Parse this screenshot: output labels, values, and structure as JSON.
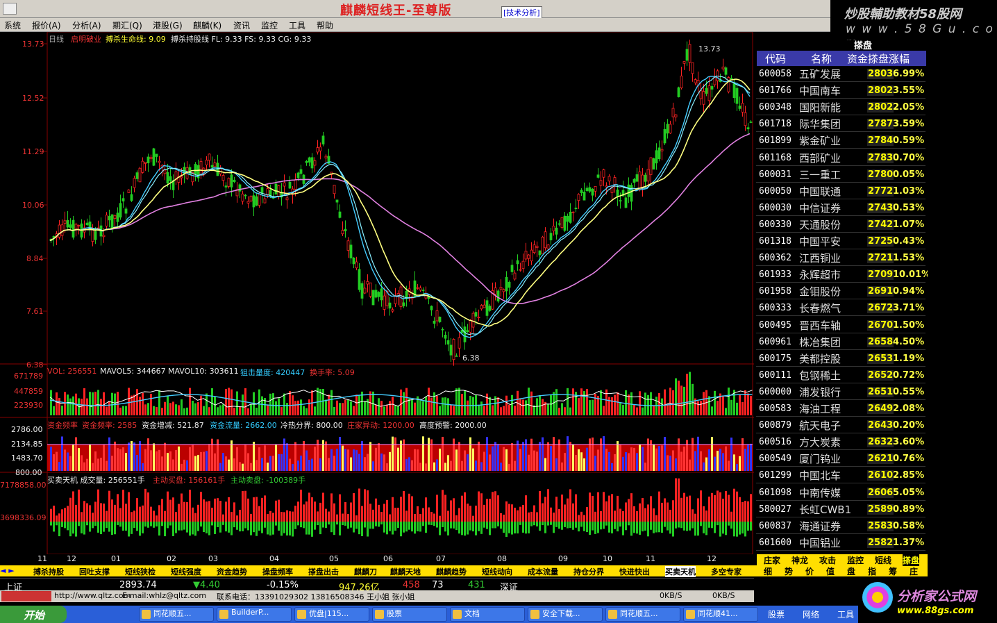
{
  "app": {
    "title": "麒麟短线王-至尊版",
    "tag": "[技术分析]"
  },
  "watermark_top": {
    "line1": "炒股輔助教材58股网",
    "line2": "w w w . 5 8 G u . c o m"
  },
  "menu": [
    "系统",
    "报价(A)",
    "分析(A)",
    "期汇(Q)",
    "港股(G)",
    "麒麟(K)",
    "资讯",
    "监控",
    "工具",
    "帮助"
  ],
  "main": {
    "label_prefix": "日线",
    "label_title": "启明破业",
    "label_a": "搏杀生命线: 9.09",
    "label_b": "搏杀持股线 FL: 9.33 FS: 9.33 CG: 9.33",
    "price_ticks": [
      "13.73",
      "12.52",
      "11.29",
      "10.06",
      "8.84",
      "7.61",
      "6.38"
    ],
    "high_marker": "13.73",
    "low_marker": "6.38"
  },
  "vol": {
    "l1": "VOL: 256551",
    "l2": "MAVOL5: 344667",
    "l3": "MAVOL10: 303611",
    "l4": "狙击量度: 420447",
    "l5": "换手率: 5.09",
    "ticks": [
      "671789",
      "447859",
      "223930"
    ]
  },
  "fund": {
    "l1": "资金频率",
    "l2": "资金频率: 2585",
    "l3": "资金增减: 521.87",
    "l4": "资金流量: 2662.00",
    "l5": "冷热分界: 800.00",
    "l6": "庄家异动: 1200.00",
    "l7": "高度预警: 2000.00",
    "ticks": [
      "2786.00",
      "2134.85",
      "1483.70",
      "800.00"
    ]
  },
  "bs": {
    "l1": "买卖天机 成交量: 256551手",
    "l2": "主动买盘: 156161手",
    "l3": "主动卖盘: -100389手",
    "ticks": [
      "7178858.00",
      "3698336.09"
    ]
  },
  "months": [
    "11",
    "12",
    "01",
    "02",
    "03",
    "04",
    "05",
    "06",
    "07",
    "08",
    "09",
    "10",
    "11",
    "12"
  ],
  "right": {
    "title": "搽盘",
    "headers": [
      "代码",
      "名称",
      "资金搽盘涨幅"
    ],
    "rows": [
      [
        "600058",
        "五矿发展",
        "2803",
        "6.99%"
      ],
      [
        "601766",
        "中国南车",
        "2802",
        "3.55%"
      ],
      [
        "600348",
        "国阳新能",
        "2802",
        "2.05%"
      ],
      [
        "601718",
        "际华集团",
        "2787",
        "3.59%"
      ],
      [
        "601899",
        "紫金矿业",
        "2784",
        "0.59%"
      ],
      [
        "601168",
        "西部矿业",
        "2783",
        "0.70%"
      ],
      [
        "600031",
        "三一重工",
        "2780",
        "0.05%"
      ],
      [
        "600050",
        "中国联通",
        "2772",
        "1.03%"
      ],
      [
        "600030",
        "中信证券",
        "2743",
        "0.53%"
      ],
      [
        "600330",
        "天通股份",
        "2742",
        "1.07%"
      ],
      [
        "601318",
        "中国平安",
        "2725",
        "0.43%"
      ],
      [
        "600362",
        "江西铜业",
        "2721",
        "1.53%"
      ],
      [
        "601933",
        "永辉超市",
        "2709",
        "10.01%"
      ],
      [
        "601958",
        "金钼股份",
        "2691",
        "0.94%"
      ],
      [
        "600333",
        "长春燃气",
        "2672",
        "3.71%"
      ],
      [
        "600495",
        "晋西车轴",
        "2670",
        "1.50%"
      ],
      [
        "600961",
        "株冶集团",
        "2658",
        "4.50%"
      ],
      [
        "600175",
        "美都控股",
        "2653",
        "1.19%"
      ],
      [
        "600111",
        "包钢稀土",
        "2652",
        "0.72%"
      ],
      [
        "600000",
        "浦发银行",
        "2651",
        "0.55%"
      ],
      [
        "600583",
        "海油工程",
        "2649",
        "2.08%"
      ],
      [
        "600879",
        "航天电子",
        "2643",
        "0.20%"
      ],
      [
        "600516",
        "方大炭素",
        "2632",
        "3.60%"
      ],
      [
        "600549",
        "厦门钨业",
        "2621",
        "0.76%"
      ],
      [
        "601299",
        "中国北车",
        "2610",
        "2.85%"
      ],
      [
        "601098",
        "中南传媒",
        "2606",
        "5.05%"
      ],
      [
        "580027",
        "长虹CWB1",
        "2589",
        "0.89%"
      ],
      [
        "600837",
        "海通证券",
        "2583",
        "0.58%"
      ],
      [
        "601600",
        "中国铝业",
        "2582",
        "1.37%"
      ]
    ]
  },
  "tabs_bottom": [
    "搏杀持股",
    "回吐支撑",
    "短线狭检",
    "短线强度",
    "资金趋势",
    "操盘频率",
    "搽盘出击",
    "麒麟刀",
    "麒麟天地",
    "麒麟趋势",
    "短线动向",
    "成本流量",
    "持仓分界",
    "快进快出",
    "买卖天机",
    "多空专家"
  ],
  "tabs_right_top": [
    "庄家",
    "神龙",
    "攻击",
    "监控",
    "短线",
    "搽盘"
  ],
  "tabs_right_bottom": [
    "细",
    "势",
    "价",
    "值",
    "盘",
    "指",
    "筹",
    "庄"
  ],
  "status": {
    "index_name": "上证",
    "index_value": "2893.74",
    "change": "▼4.40",
    "pct": "-0.15%",
    "amount": "947.26亿",
    "up": "458",
    "flat": "73",
    "down": "431",
    "other": "深证"
  },
  "status2": {
    "url": "http://www.qltz.com",
    "email": "E-mail:whlz@qltz.com",
    "phone": "联系电话：13391029302  13816508346 王小姐 张小姐",
    "net1": "0KB/S",
    "net2": "0KB/S"
  },
  "taskbar": {
    "start": "开始",
    "buttons": [
      "同花顺五...",
      "BuilderP...",
      "优盘|115...",
      "股票",
      "文档",
      "安全下载...",
      "同花顺五...",
      "同花顺41..."
    ],
    "tray": [
      "股票",
      "网络",
      "工具"
    ]
  },
  "watermark_bottom": {
    "line1": "分析家公式网",
    "line2": "www.88gs.com"
  }
}
